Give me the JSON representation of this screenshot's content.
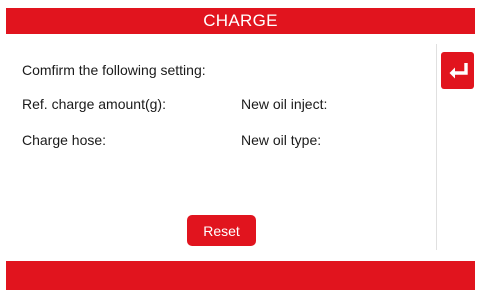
{
  "header": {
    "title": "CHARGE"
  },
  "main": {
    "confirm_text": "Comfirm the following setting:",
    "ref_charge_label": "Ref. charge amount(g):",
    "new_oil_inject_label": "New oil inject:",
    "charge_hose_label": "Charge hose:",
    "new_oil_type_label": "New oil type:"
  },
  "actions": {
    "reset_label": "Reset",
    "back_icon": "return-enter-icon"
  },
  "colors": {
    "accent": "#e1141e",
    "background": "#ffffff",
    "text": "#1a1a1a"
  }
}
